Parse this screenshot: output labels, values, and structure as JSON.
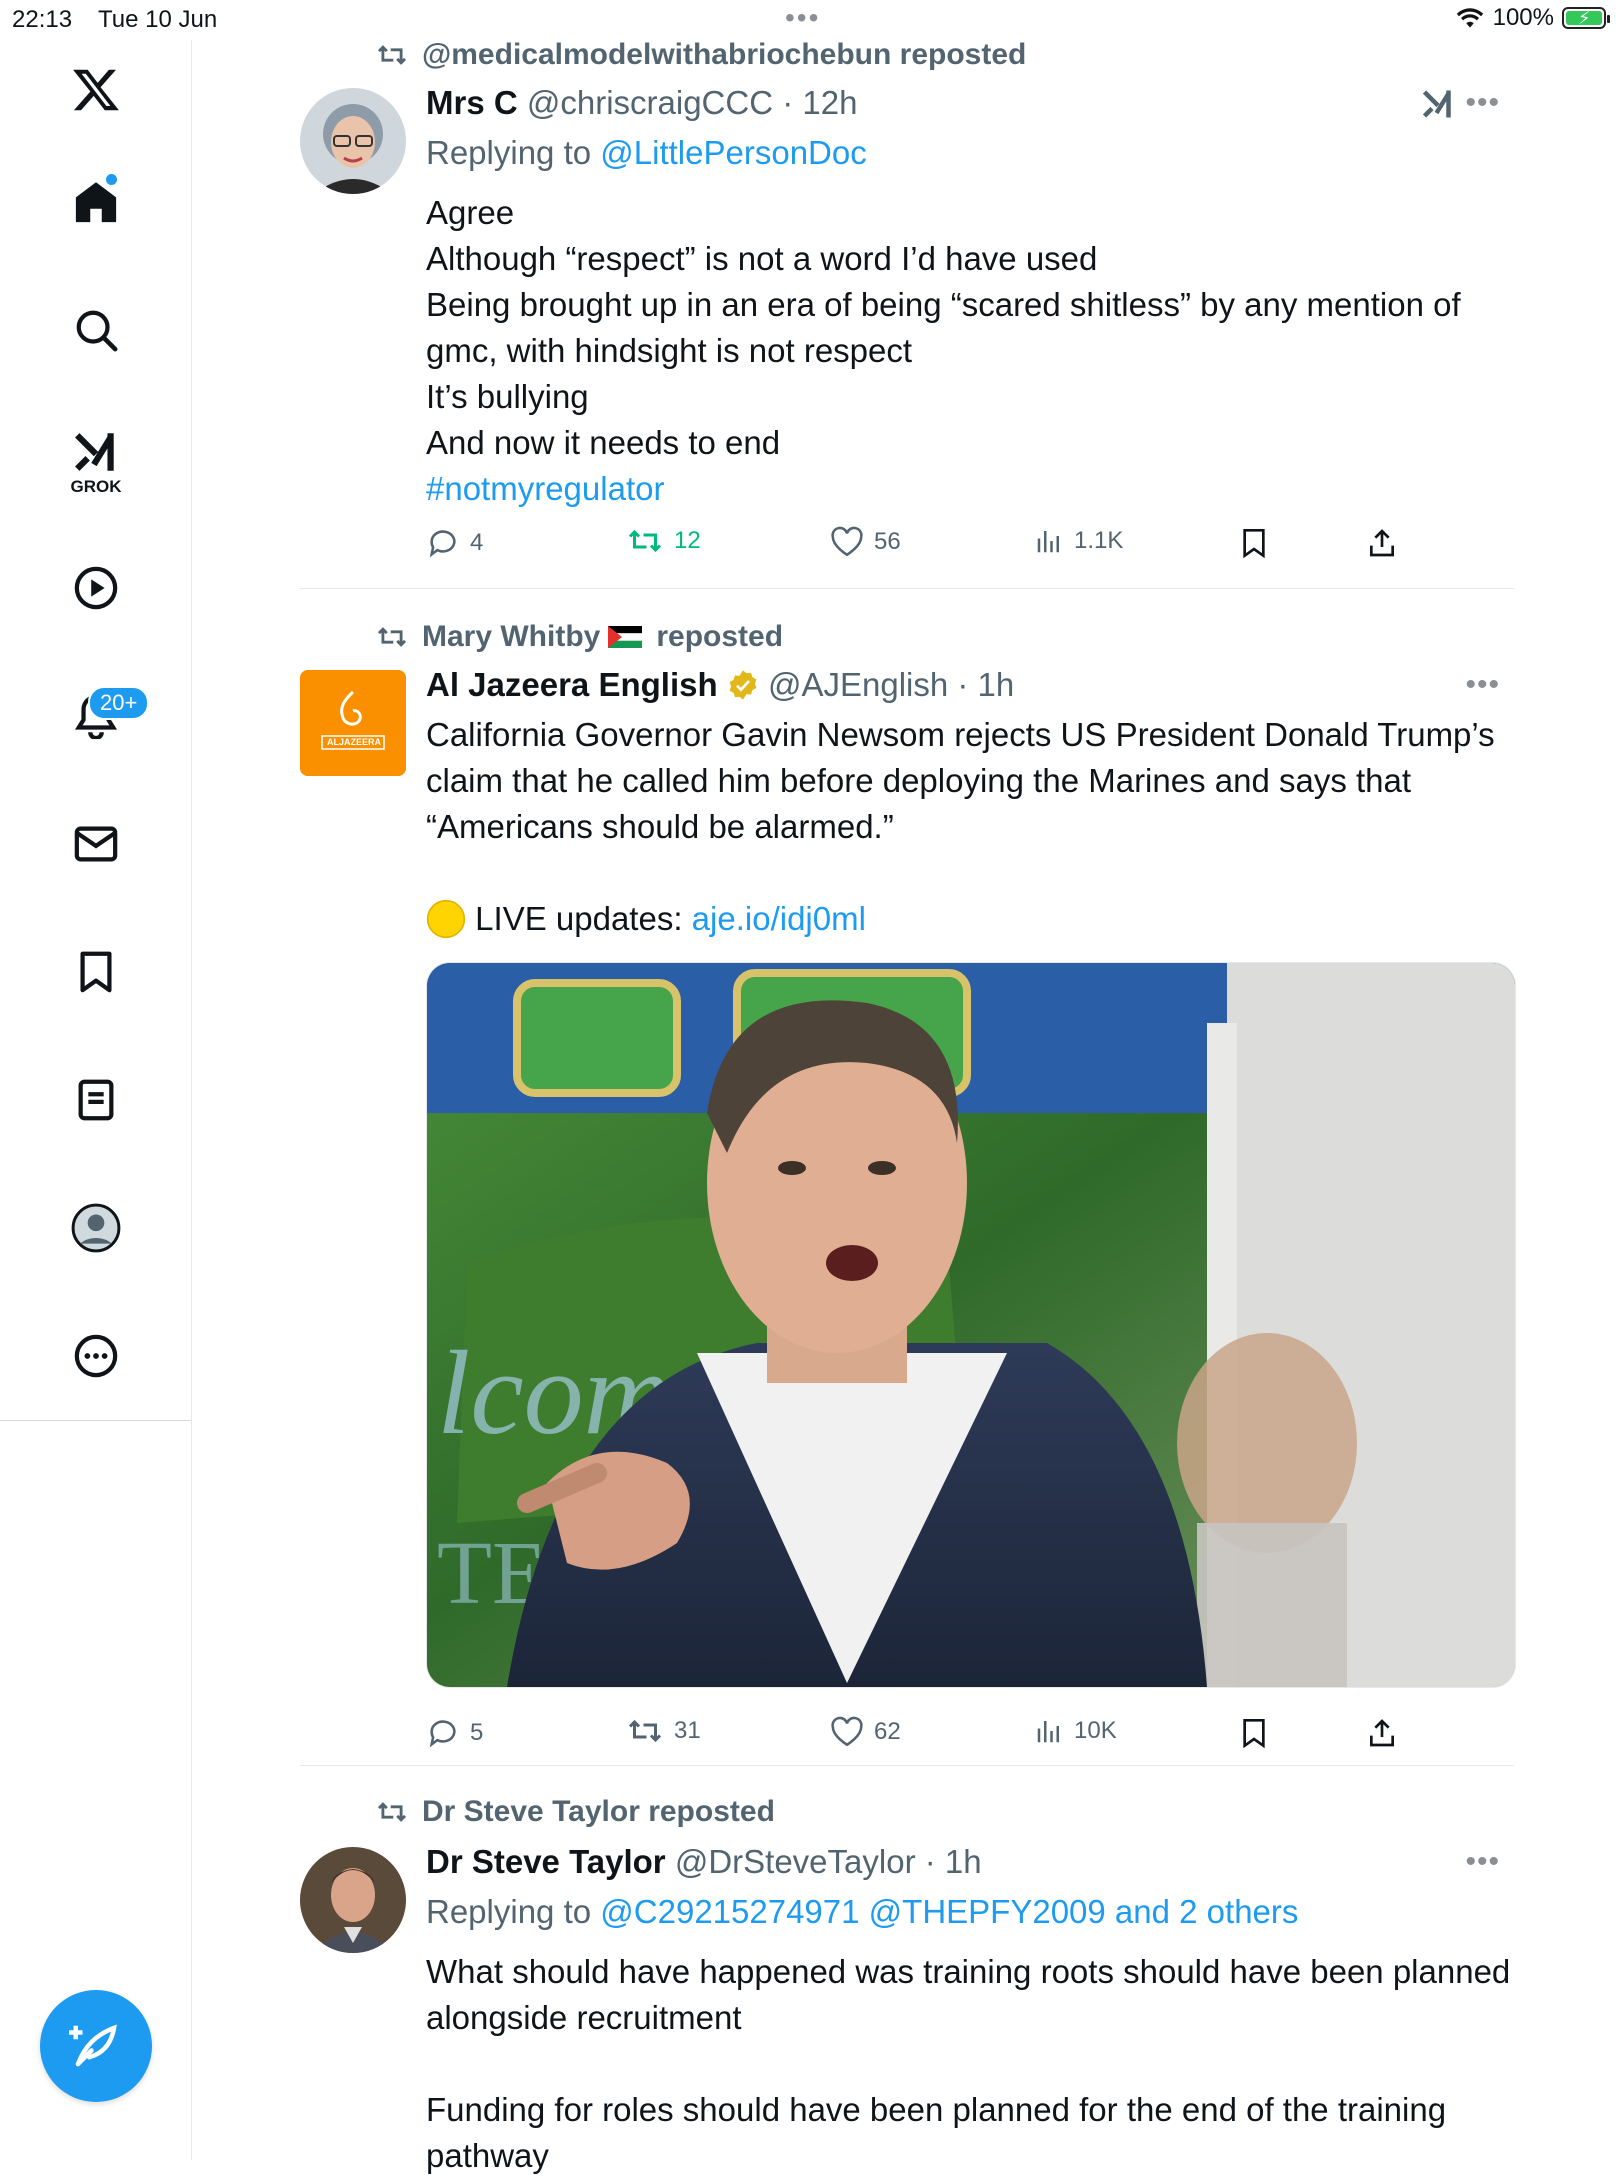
{
  "status_bar": {
    "time": "22:13",
    "date": "Tue 10 Jun",
    "battery": "100%"
  },
  "sidebar": {
    "items": [
      {
        "name": "x-logo"
      },
      {
        "name": "home"
      },
      {
        "name": "search"
      },
      {
        "name": "grok",
        "label": "GROK"
      },
      {
        "name": "video"
      },
      {
        "name": "notifications",
        "badge": "20+"
      },
      {
        "name": "messages"
      },
      {
        "name": "bookmarks"
      },
      {
        "name": "lists"
      },
      {
        "name": "profile"
      },
      {
        "name": "more"
      }
    ],
    "grok_label": "GROK",
    "notifications_badge": "20+"
  },
  "posts": [
    {
      "repost_by": "@medicalmodelwithabriochebun reposted",
      "name": "Mrs C",
      "handle": "@chriscraigCCC",
      "time": "· 12h",
      "replying_prefix": "Replying to",
      "replying_to": "@LittlePersonDoc",
      "lines": [
        "Agree",
        "Although “respect” is not a word I’d have used",
        "Being brought up in an era of being “scared shitless” by any mention of gmc, with hindsight is not respect",
        "It’s bullying",
        "And now it needs to end"
      ],
      "hashtag": "#notmyregulator",
      "replies": "4",
      "reposts": "12",
      "likes": "56",
      "views": "1.1K"
    },
    {
      "repost_by": "Mary Whitby",
      "repost_suffix": "reposted",
      "name": "Al Jazeera English",
      "handle": "@AJEnglish",
      "time": "· 1h",
      "text": "California Governor Gavin Newsom rejects US President Donald Trump’s claim that he called him before deploying the Marines and says that “Americans should be alarmed.”",
      "live_label": "LIVE updates:",
      "live_link": "aje.io/idj0ml",
      "avatar_text": "ALJAZEERA",
      "replies": "5",
      "reposts": "31",
      "likes": "62",
      "views": "10K"
    },
    {
      "repost_by": "Dr Steve Taylor reposted",
      "name": "Dr Steve Taylor",
      "handle": "@DrSteveTaylor",
      "time": "· 1h",
      "replying_prefix": "Replying to",
      "replying_to": "@C29215274971 @THEPFY2009 and 2 others",
      "para1": "What should have happened was training roots should have been planned alongside recruitment",
      "para2": "Funding for roles should have been planned for the end of the training pathway"
    }
  ],
  "colors": {
    "accent": "#1d9bf0",
    "repost_green": "#00ba7c",
    "muted": "#536471",
    "verified_gold": "#e2b719"
  }
}
